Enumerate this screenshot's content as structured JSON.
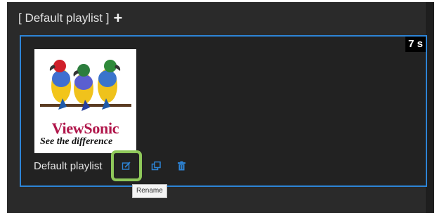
{
  "header": {
    "title": "[ Default playlist ]",
    "add_icon": "plus-icon"
  },
  "card": {
    "duration": "7 s",
    "thumbnail": {
      "brand": "ViewSonic",
      "tagline": "See the difference"
    },
    "name": "Default playlist",
    "actions": [
      {
        "icon": "edit-icon",
        "tooltip": "Rename"
      },
      {
        "icon": "duplicate-icon"
      },
      {
        "icon": "trash-icon"
      }
    ],
    "accent_color": "#2d84d6"
  },
  "tooltip": {
    "text": "Rename"
  }
}
